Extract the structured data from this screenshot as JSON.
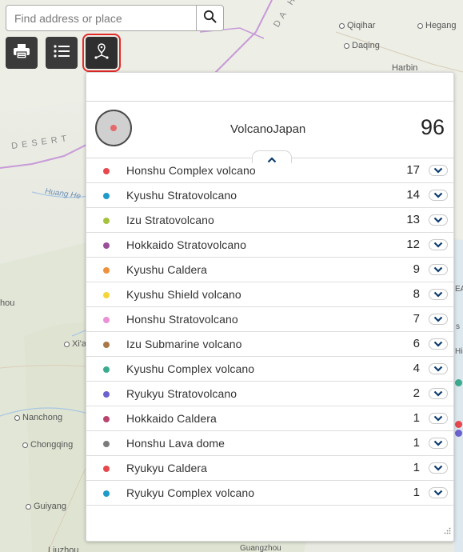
{
  "search": {
    "placeholder": "Find address or place"
  },
  "toolbar": {
    "print_icon": "print-icon",
    "layer_list_icon": "list-icon",
    "cluster_icon": "location-pin-network-icon"
  },
  "map_labels": {
    "qiqihar": "Qiqihar",
    "hegang": "Hegang",
    "daqing": "Daqing",
    "harbin": "Harbin",
    "da_hinggan": "DA HING",
    "desert": "DESERT",
    "huang_he": "Huang He",
    "hou": "hou",
    "xian": "Xi'a",
    "nanchong": "Nanchong",
    "chongqing": "Chongqing",
    "guiyang": "Guiyang",
    "liuzhou": "Liuzhou",
    "guangzhou": "Guangzhou",
    "edge_ea": "EA",
    "edge_s": "s",
    "edge_hi": "Hi"
  },
  "panel": {
    "title": "VolcanoJapan",
    "total": "96",
    "symbol_color": "#e5686a",
    "rows": [
      {
        "label": "Honshu Complex volcano",
        "count": "17",
        "color": "#e5484d"
      },
      {
        "label": "Kyushu Stratovolcano",
        "count": "14",
        "color": "#1f9ac9"
      },
      {
        "label": "Izu Stratovolcano",
        "count": "13",
        "color": "#a6c23c"
      },
      {
        "label": "Hokkaido Stratovolcano",
        "count": "12",
        "color": "#9b4f99"
      },
      {
        "label": "Kyushu Caldera",
        "count": "9",
        "color": "#f0913a"
      },
      {
        "label": "Kyushu Shield volcano",
        "count": "8",
        "color": "#f5d63a"
      },
      {
        "label": "Honshu Stratovolcano",
        "count": "7",
        "color": "#ec8fd6"
      },
      {
        "label": "Izu Submarine volcano",
        "count": "6",
        "color": "#a87848"
      },
      {
        "label": "Kyushu Complex volcano",
        "count": "4",
        "color": "#3bab8f"
      },
      {
        "label": "Ryukyu Stratovolcano",
        "count": "2",
        "color": "#6a62cf"
      },
      {
        "label": "Hokkaido Caldera",
        "count": "1",
        "color": "#b8456f"
      },
      {
        "label": "Honshu Lava dome",
        "count": "1",
        "color": "#7b7b7b"
      },
      {
        "label": "Ryukyu Caldera",
        "count": "1",
        "color": "#e5484d"
      },
      {
        "label": "Ryukyu Complex volcano",
        "count": "1",
        "color": "#1f9ac9"
      }
    ]
  }
}
